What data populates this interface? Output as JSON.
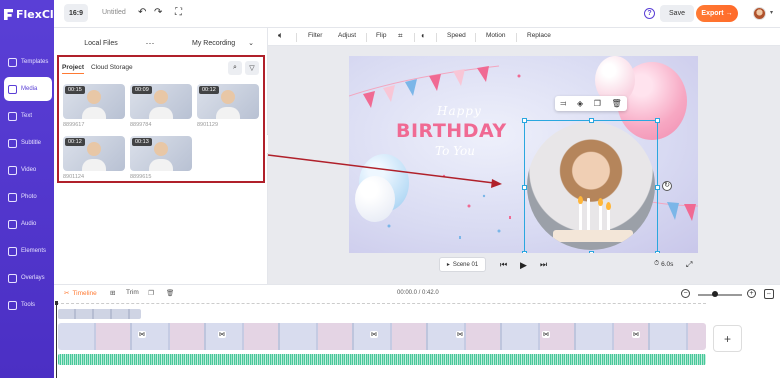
{
  "app": {
    "name": "FlexClip"
  },
  "sidebar": {
    "items": [
      {
        "label": "Templates",
        "icon": "templates-icon"
      },
      {
        "label": "Media",
        "icon": "media-icon",
        "active": true
      },
      {
        "label": "Text",
        "icon": "text-icon"
      },
      {
        "label": "Subtitle",
        "icon": "subtitle-icon"
      },
      {
        "label": "Video",
        "icon": "video-icon"
      },
      {
        "label": "Photo",
        "icon": "photo-icon"
      },
      {
        "label": "Audio",
        "icon": "audio-icon"
      },
      {
        "label": "Elements",
        "icon": "elements-icon"
      },
      {
        "label": "Overlays",
        "icon": "overlays-icon"
      },
      {
        "label": "Tools",
        "icon": "tools-icon"
      }
    ]
  },
  "topbar": {
    "ratio": "16:9",
    "title": "Untitled",
    "help": "?",
    "save": "Save",
    "export": "Export",
    "export_arrow": "→"
  },
  "media_panel": {
    "source_local": "Local Files",
    "more": "···",
    "source_recording": "My Recording",
    "tabs": [
      {
        "label": "Project",
        "active": true
      },
      {
        "label": "Cloud Storage"
      }
    ],
    "items": [
      {
        "duration": "00:15",
        "id": "8899617"
      },
      {
        "duration": "00:09",
        "id": "8899784"
      },
      {
        "duration": "00:12",
        "id": "8901129"
      },
      {
        "duration": "00:12",
        "id": "8901124"
      },
      {
        "duration": "00:13",
        "id": "8899615"
      }
    ]
  },
  "edit_toolbar": {
    "items": [
      "Filter",
      "Adjust",
      "Flip",
      "Speed",
      "Motion",
      "Replace"
    ]
  },
  "canvas": {
    "line1": "Happy",
    "line2": "BIRTHDAY",
    "line3": "To You",
    "colors": {
      "title": "#f06a93",
      "selection": "#2aa7df",
      "annotation": "#b0202a"
    }
  },
  "playback": {
    "scene": "Scene 01",
    "duration": "6.0s"
  },
  "timeline": {
    "tab_timeline": "Timeline",
    "tab_trim": "Trim",
    "time": "00:00.0 / 0:42.0",
    "zoom_out": "−",
    "zoom_in": "+",
    "add_clip": "+"
  },
  "accent": "#5a3fd6",
  "export_color": "#ff7a33"
}
